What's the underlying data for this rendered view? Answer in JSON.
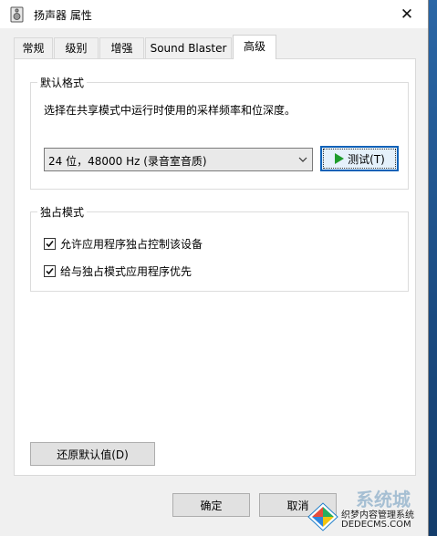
{
  "window": {
    "title": "扬声器 属性",
    "close_glyph": "✕"
  },
  "tabs": [
    {
      "label": "常规",
      "active": false
    },
    {
      "label": "级别",
      "active": false
    },
    {
      "label": "增强",
      "active": false
    },
    {
      "label": "Sound Blaster",
      "active": false
    },
    {
      "label": "高级",
      "active": true
    }
  ],
  "default_format": {
    "group_label": "默认格式",
    "description": "选择在共享模式中运行时使用的采样频率和位深度。",
    "selected_format": "24 位，48000 Hz (录音室音质)",
    "test_button_label": "测试(T)"
  },
  "exclusive_mode": {
    "group_label": "独占模式",
    "options": [
      {
        "label": "允许应用程序独占控制该设备",
        "checked": true
      },
      {
        "label": "给与独占模式应用程序优先",
        "checked": true
      }
    ]
  },
  "buttons": {
    "restore_defaults": "还原默认值(D)",
    "ok": "确定",
    "cancel": "取消"
  },
  "watermark": {
    "brand": "系统城",
    "line1": "织梦内容管理系统",
    "line2": "DEDECMS.COM"
  },
  "colors": {
    "accent": "#0e62b8",
    "play_green": "#1e9c2c",
    "desktop_blue": "#1d4f86"
  }
}
